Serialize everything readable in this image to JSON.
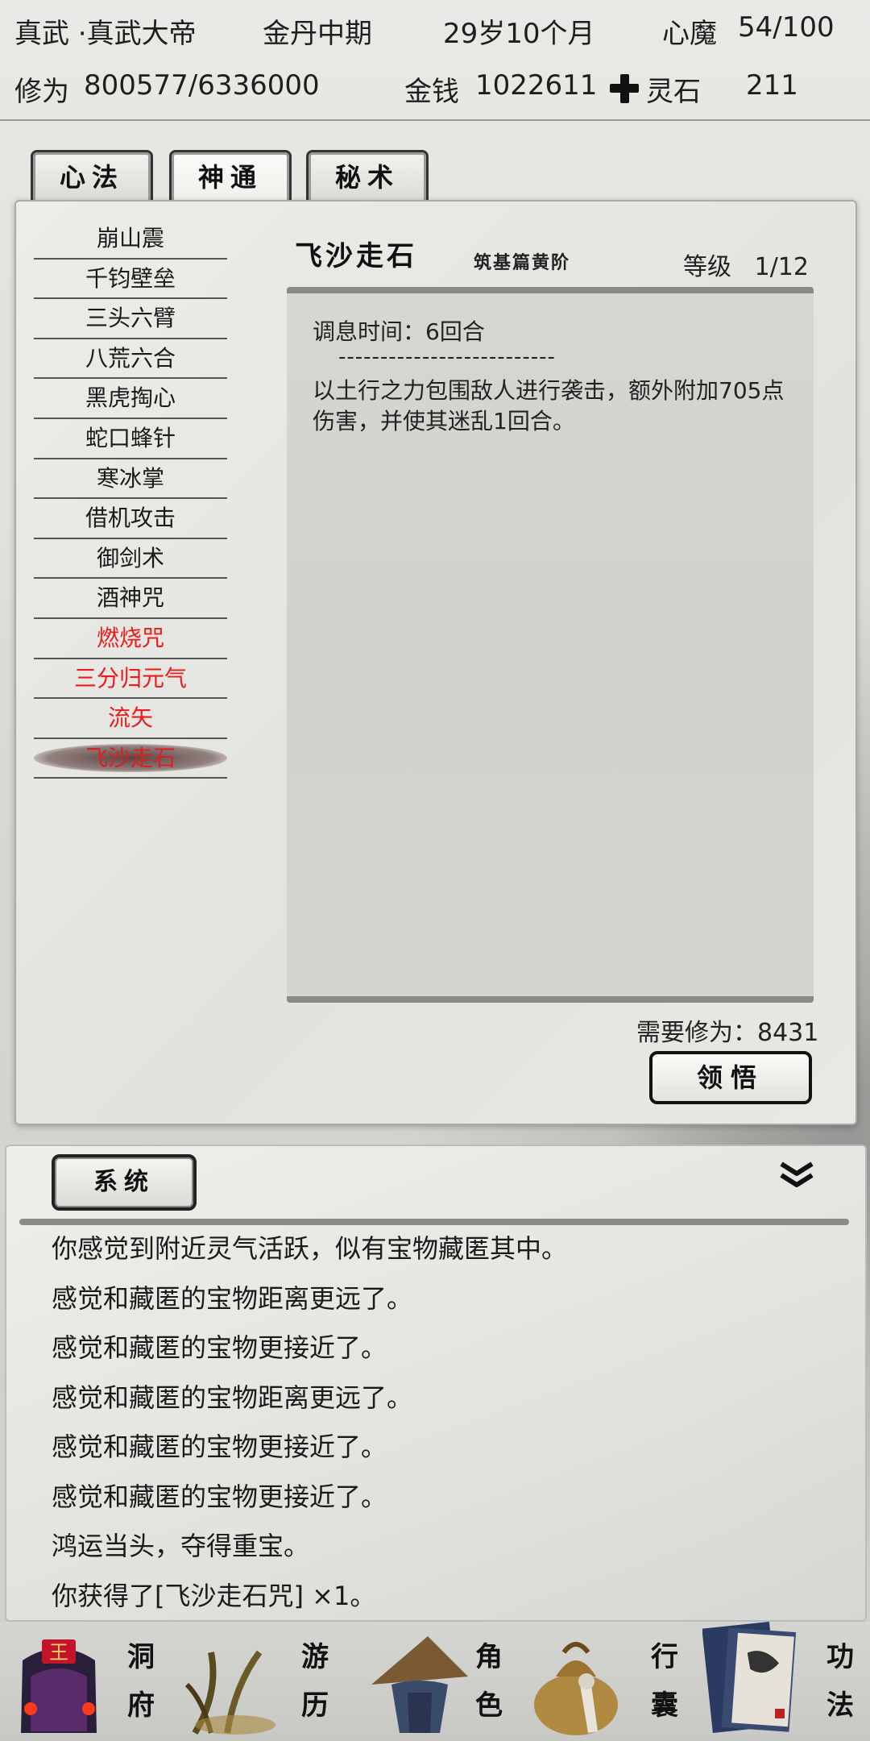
{
  "status": {
    "name": "真武 ·真武大帝",
    "realm": "金丹中期",
    "age": "29岁10个月",
    "heart_demon_label": "心魔",
    "heart_demon_value": "54/100",
    "cultivation_label": "修为",
    "cultivation_value": "800577/6336000",
    "money_label": "金钱",
    "money_value": "1022611",
    "spirit_stone_label": "灵石",
    "spirit_stone_value": "211"
  },
  "tabs": [
    {
      "label": "心法",
      "active": false
    },
    {
      "label": "神通",
      "active": true
    },
    {
      "label": "秘术",
      "active": false
    }
  ],
  "skills": [
    {
      "label": "崩山震",
      "color": "normal"
    },
    {
      "label": "千钧壁垒",
      "color": "normal"
    },
    {
      "label": "三头六臂",
      "color": "normal"
    },
    {
      "label": "八荒六合",
      "color": "normal"
    },
    {
      "label": "黑虎掏心",
      "color": "normal"
    },
    {
      "label": "蛇口蜂针",
      "color": "normal"
    },
    {
      "label": "寒冰掌",
      "color": "normal"
    },
    {
      "label": "借机攻击",
      "color": "normal"
    },
    {
      "label": "御剑术",
      "color": "normal"
    },
    {
      "label": "酒神咒",
      "color": "normal"
    },
    {
      "label": "燃烧咒",
      "color": "red"
    },
    {
      "label": "三分归元气",
      "color": "red"
    },
    {
      "label": "流矢",
      "color": "red"
    },
    {
      "label": "飞沙走石",
      "color": "red",
      "selected": true
    }
  ],
  "detail": {
    "title": "飞沙走石",
    "tier": "筑基篇黄阶",
    "level_label": "等级",
    "level_value": "1/12",
    "cooldown": "调息时间：6回合",
    "separator": "--------------------------",
    "description": "以土行之力包围敌人进行袭击，额外附加705点伤害，并使其迷乱1回合。",
    "requirement": "需要修为：8431",
    "learn_button": "领悟"
  },
  "log": {
    "tab_label": "系统",
    "lines": [
      "你感觉到附近灵气活跃，似有宝物藏匿其中。",
      "感觉和藏匿的宝物距离更远了。",
      "感觉和藏匿的宝物更接近了。",
      "感觉和藏匿的宝物距离更远了。",
      "感觉和藏匿的宝物更接近了。",
      "感觉和藏匿的宝物更接近了。",
      "鸿运当头，夺得重宝。",
      "你获得了[飞沙走石咒] ×1。"
    ]
  },
  "nav": [
    {
      "label1": "洞",
      "label2": "府",
      "icon": "cave-dwelling-icon",
      "badge": "王"
    },
    {
      "label1": "游",
      "label2": "历",
      "icon": "travel-icon"
    },
    {
      "label1": "角",
      "label2": "色",
      "icon": "character-hat-icon"
    },
    {
      "label1": "行",
      "label2": "囊",
      "icon": "bag-icon"
    },
    {
      "label1": "功",
      "label2": "法",
      "icon": "books-icon"
    }
  ]
}
